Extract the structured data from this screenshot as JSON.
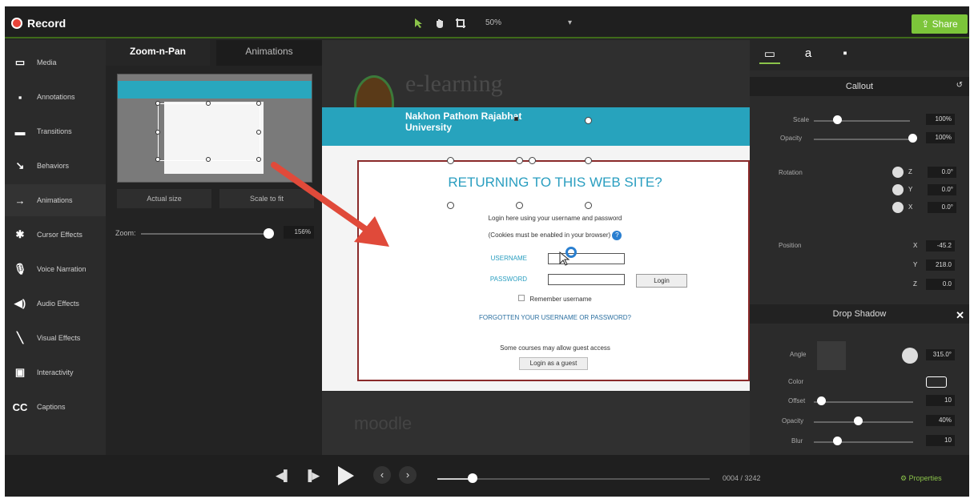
{
  "topbar": {
    "record_label": "Record",
    "zoom_value": "50%",
    "share_label": "Share"
  },
  "nav": {
    "items": [
      {
        "icon": "media-icon",
        "label": "Media"
      },
      {
        "icon": "annotations-icon",
        "label": "Annotations"
      },
      {
        "icon": "transitions-icon",
        "label": "Transitions"
      },
      {
        "icon": "behaviors-icon",
        "label": "Behaviors"
      },
      {
        "icon": "animations-icon",
        "label": "Animations"
      },
      {
        "icon": "cursor-effects-icon",
        "label": "Cursor Effects"
      },
      {
        "icon": "voice-narration-icon",
        "label": "Voice Narration"
      },
      {
        "icon": "audio-effects-icon",
        "label": "Audio Effects"
      },
      {
        "icon": "visual-effects-icon",
        "label": "Visual Effects"
      },
      {
        "icon": "interactivity-icon",
        "label": "Interactivity"
      },
      {
        "icon": "captions-icon",
        "label": "Captions"
      }
    ],
    "captions_glyph": "CC"
  },
  "panel": {
    "tab_zoom": "Zoom-n-Pan",
    "tab_animations": "Animations",
    "actual_size": "Actual size",
    "scale_to_fit": "Scale to fit",
    "zoom_label": "Zoom:",
    "zoom_value": "156%"
  },
  "canvas": {
    "site_title": "e-learning",
    "university": "Nakhon Pathom Rajabhat University",
    "heading": "RETURNING TO THIS WEB SITE?",
    "login_hint": "Login here using your username and password",
    "cookies_hint": "(Cookies must be enabled in your browser)",
    "username_label": "USERNAME",
    "password_label": "PASSWORD",
    "login_button": "Login",
    "remember": "Remember username",
    "forgot": "FORGOTTEN YOUR USERNAME OR PASSWORD?",
    "guest_hint": "Some courses may allow guest access",
    "guest_button": "Login as a guest",
    "moodle": "moodle"
  },
  "properties": {
    "tab_text_glyph": "a",
    "callout_title": "Callout",
    "scale_label": "Scale",
    "scale_value": "100%",
    "opacity_label": "Opacity",
    "opacity_value": "100%",
    "rotation_label": "Rotation",
    "rot_z": "0.0°",
    "rot_y": "0.0°",
    "rot_x": "0.0°",
    "position_label": "Position",
    "pos_x": "-45.2",
    "pos_y": "218.0",
    "pos_z": "0.0",
    "axis_x": "X",
    "axis_y": "Y",
    "axis_z": "Z",
    "drop_shadow_title": "Drop Shadow",
    "angle_label": "Angle",
    "angle_value": "315.0°",
    "color_label": "Color",
    "offset_label": "Offset",
    "offset_value": "10",
    "ds_opacity_label": "Opacity",
    "ds_opacity_value": "40%",
    "blur_label": "Blur",
    "blur_value": "10"
  },
  "playback": {
    "timecode": "0004 / 3242",
    "properties_label": "Properties"
  },
  "colors": {
    "accent": "#8bc34a",
    "record": "#e8443a",
    "teal": "#27a3bd",
    "arrow": "#e04a3a"
  }
}
